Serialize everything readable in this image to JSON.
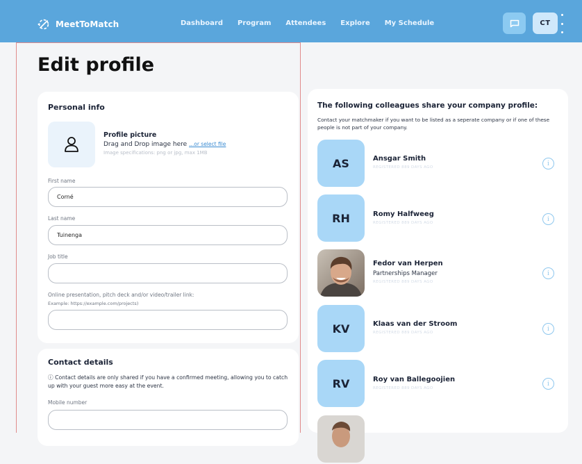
{
  "app": {
    "name": "MeetToMatch"
  },
  "nav": {
    "items": [
      "Dashboard",
      "Program",
      "Attendees",
      "Explore",
      "My Schedule"
    ]
  },
  "header": {
    "avatar_initials": "CT",
    "icons": [
      "chat-icon",
      "kebab-menu-icon"
    ]
  },
  "page": {
    "title": "Edit profile"
  },
  "personal_info": {
    "title": "Personal info",
    "picture": {
      "title": "Profile picture",
      "drop_text": "Drag and Drop image here",
      "select_link": "...or select file",
      "specs": "Image specifications: png or jpg, max 1MB"
    },
    "first_name": {
      "label": "First name",
      "value": "Corné"
    },
    "last_name": {
      "label": "Last name",
      "value": "Tuinenga"
    },
    "job_title": {
      "label": "Job title",
      "value": ""
    },
    "presentation": {
      "label": "Online presentation, pitch deck and/or video/trailer link:",
      "hint": "Example: https://example.com/projects)",
      "value": ""
    }
  },
  "contact": {
    "title": "Contact details",
    "note": "ⓘ Contact details are only shared if you have a confirmed meeting, allowing you to catch up with your guest more easy at the event.",
    "mobile": {
      "label": "Mobile number",
      "value": ""
    }
  },
  "colleagues": {
    "title": "The following colleagues share your company profile:",
    "note": "Contact your matchmaker if you want to be listed as a seperate company or if one of these people is not part of your company.",
    "list": [
      {
        "initials": "AS",
        "name": "Ansgar Smith",
        "job": "",
        "registered": "REGISTERED 889 DAYS AGO",
        "photo": false
      },
      {
        "initials": "RH",
        "name": "Romy Halfweeg",
        "job": "",
        "registered": "REGISTERED 889 DAYS AGO",
        "photo": false
      },
      {
        "initials": "",
        "name": "Fedor van Herpen",
        "job": "Partnerships Manager",
        "registered": "REGISTERED 889 DAYS AGO",
        "photo": true
      },
      {
        "initials": "KV",
        "name": "Klaas van der Stroom",
        "job": "",
        "registered": "REGISTERED 889 DAYS AGO",
        "photo": false
      },
      {
        "initials": "RV",
        "name": "Roy van Ballegoojien",
        "job": "",
        "registered": "REGISTERED 889 DAYS AGO",
        "photo": false
      },
      {
        "initials": "",
        "name": "",
        "job": "",
        "registered": "",
        "photo": true
      }
    ]
  },
  "colors": {
    "nav_bg": "#5aa6dc",
    "initials_bg": "#a9d7f7",
    "page_bg": "#f4f5f7",
    "accent": "#3a8bd2"
  }
}
